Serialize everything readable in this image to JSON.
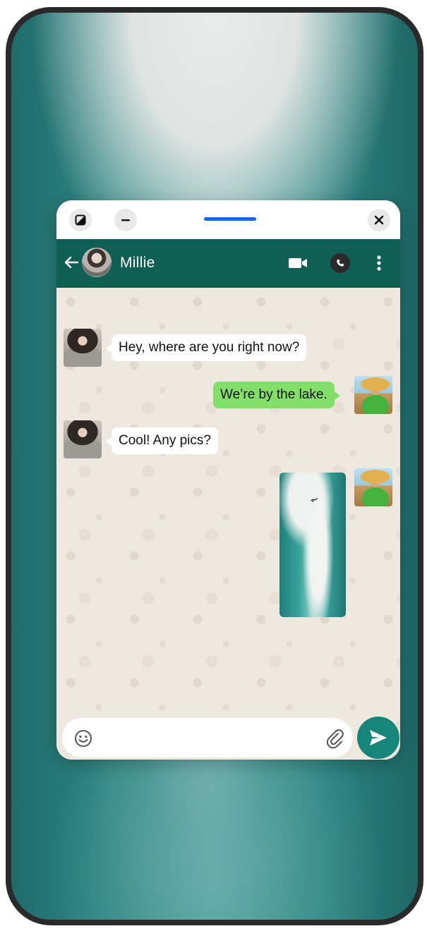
{
  "window": {
    "controls": [
      "fullscreen-icon",
      "minimize-icon",
      "close-icon"
    ],
    "accent": "#1565e8"
  },
  "header": {
    "contact_name": "Millie",
    "bg_color": "#0f5f55",
    "icons": [
      "back-arrow-icon",
      "video-call-icon",
      "phone-icon",
      "more-vert-icon"
    ]
  },
  "messages": [
    {
      "from": "Millie",
      "direction": "in",
      "text": "Hey, where are you right now?"
    },
    {
      "from": "me",
      "direction": "out",
      "text": "We’re by the lake."
    },
    {
      "from": "Millie",
      "direction": "in",
      "text": "Cool! Any pics?"
    },
    {
      "from": "me",
      "direction": "out",
      "type": "photo"
    }
  ],
  "colors": {
    "incoming_bubble": "#ffffff",
    "outgoing_bubble": "#82e06a",
    "send_button": "#16857a"
  },
  "composer": {
    "placeholder": "",
    "icons": [
      "emoji-icon",
      "attach-icon",
      "send-icon"
    ]
  }
}
